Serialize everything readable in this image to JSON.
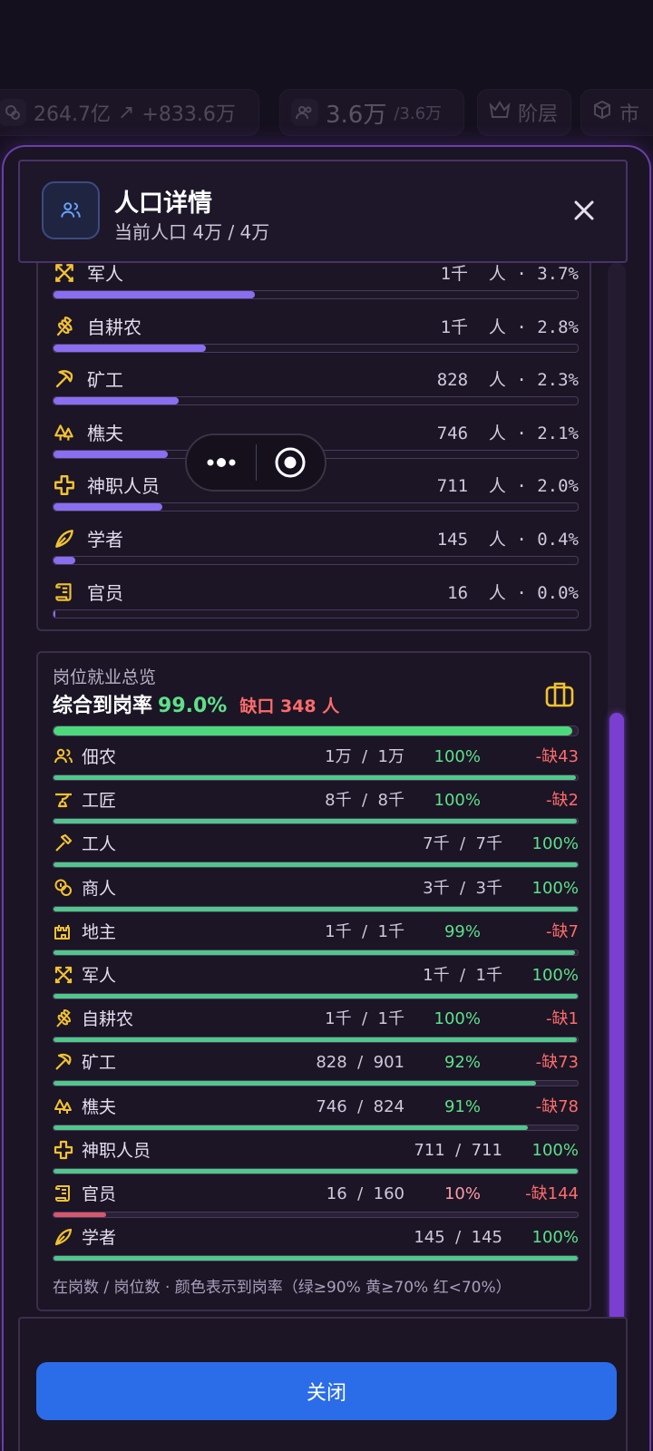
{
  "topbar": {
    "gold": "264.7亿",
    "gold_delta": "+833.6万",
    "pop_value": "3.6万",
    "pop_cap": "/3.6万",
    "strata_label": "阶层",
    "market_label": "市"
  },
  "header": {
    "title": "人口详情",
    "subtitle": "当前人口 4万 / 4万",
    "icon": "people-icon"
  },
  "population": [
    {
      "name": "军人",
      "value": "1千  人 · 3.7%",
      "share": 3.7,
      "icon": "crossed-swords-icon"
    },
    {
      "name": "自耕农",
      "value": "1千  人 · 2.8%",
      "share": 2.8,
      "icon": "wheat-icon"
    },
    {
      "name": "矿工",
      "value": "828  人 · 2.3%",
      "share": 2.3,
      "icon": "pickaxe-icon"
    },
    {
      "name": "樵夫",
      "value": "746  人 · 2.1%",
      "share": 2.1,
      "icon": "trees-icon"
    },
    {
      "name": "神职人员",
      "value": "711  人 · 2.0%",
      "share": 2.0,
      "icon": "cross-icon"
    },
    {
      "name": "学者",
      "value": "145  人 · 0.4%",
      "share": 0.4,
      "icon": "quill-icon"
    },
    {
      "name": "官员",
      "value": "16  人 · 0.0%",
      "share": 0.0,
      "icon": "scroll-icon"
    }
  ],
  "jobs": {
    "title": "岗位就业总览",
    "rate_label": "综合到岗率",
    "rate_value": "99.0%",
    "rate_fraction": 0.99,
    "gap_label": "缺口 348 人",
    "footnote": "在岗数 / 岗位数 · 颜色表示到岗率（绿≥90% 黄≥70% 红<70%）",
    "rows": [
      {
        "name": "佃农",
        "nums": "1万  /  1万",
        "pct": "100%",
        "short": "-缺43",
        "ratio": 0.996,
        "icon": "people-icon",
        "status": "green"
      },
      {
        "name": "工匠",
        "nums": "8千  /  8千",
        "pct": "100%",
        "short": "-缺2",
        "ratio": 0.999,
        "icon": "anvil-icon",
        "status": "green"
      },
      {
        "name": "工人",
        "nums": "7千  /  7千",
        "pct": "100%",
        "short": "",
        "ratio": 1.0,
        "icon": "hammer-icon",
        "status": "green"
      },
      {
        "name": "商人",
        "nums": "3千  /  3千",
        "pct": "100%",
        "short": "",
        "ratio": 1.0,
        "icon": "coins-icon",
        "status": "green"
      },
      {
        "name": "地主",
        "nums": "1千  /  1千",
        "pct": "99%",
        "short": "-缺7",
        "ratio": 0.995,
        "icon": "castle-icon",
        "status": "green"
      },
      {
        "name": "军人",
        "nums": "1千  /  1千",
        "pct": "100%",
        "short": "",
        "ratio": 1.0,
        "icon": "crossed-swords-icon",
        "status": "green"
      },
      {
        "name": "自耕农",
        "nums": "1千  /  1千",
        "pct": "100%",
        "short": "-缺1",
        "ratio": 0.999,
        "icon": "wheat-icon",
        "status": "green"
      },
      {
        "name": "矿工",
        "nums": "828  /  901",
        "pct": "92%",
        "short": "-缺73",
        "ratio": 0.92,
        "icon": "pickaxe-icon",
        "status": "green"
      },
      {
        "name": "樵夫",
        "nums": "746  /  824",
        "pct": "91%",
        "short": "-缺78",
        "ratio": 0.905,
        "icon": "trees-icon",
        "status": "green"
      },
      {
        "name": "神职人员",
        "nums": "711  /  711",
        "pct": "100%",
        "short": "",
        "ratio": 1.0,
        "icon": "cross-icon",
        "status": "green"
      },
      {
        "name": "官员",
        "nums": "16  /  160",
        "pct": "10%",
        "short": "-缺144",
        "ratio": 0.1,
        "icon": "scroll-icon",
        "status": "red"
      },
      {
        "name": "学者",
        "nums": "145  /  145",
        "pct": "100%",
        "short": "",
        "ratio": 1.0,
        "icon": "quill-icon",
        "status": "green"
      }
    ]
  },
  "footer": {
    "close_label": "关闭"
  },
  "colors": {
    "accent_purple": "#7a3fd0",
    "green": "#5ee08a",
    "red": "#ff6b6b",
    "pink": "#ff9aa8",
    "gold_icon": "#f2c230",
    "button_blue": "#2b6de8"
  }
}
